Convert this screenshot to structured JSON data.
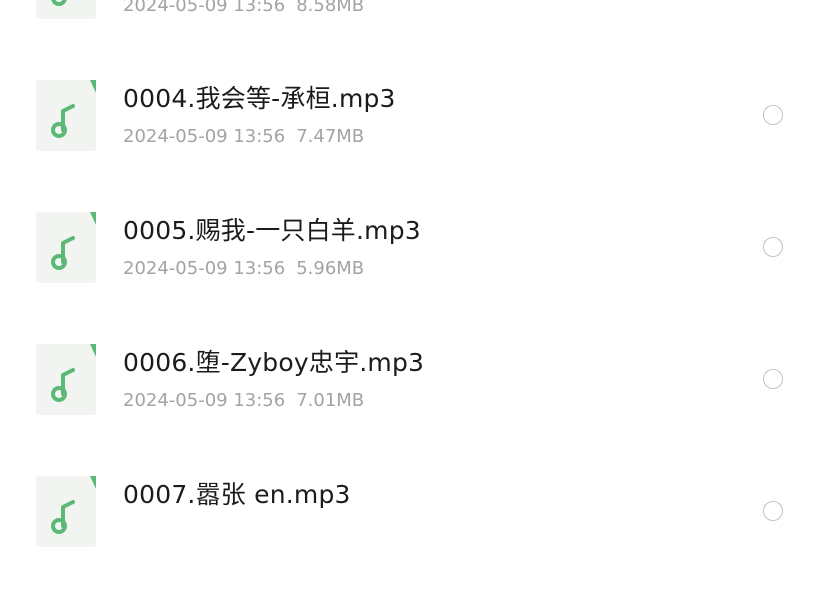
{
  "files": [
    {
      "name": "",
      "date": "2024-05-09 13:56",
      "size": "8.58MB",
      "icon": "music-file-icon"
    },
    {
      "name": "0004.我会等-承桓.mp3",
      "date": "2024-05-09 13:56",
      "size": "7.47MB",
      "icon": "music-file-icon"
    },
    {
      "name": "0005.赐我-一只白羊.mp3",
      "date": "2024-05-09 13:56",
      "size": "5.96MB",
      "icon": "music-file-icon"
    },
    {
      "name": "0006.堕-Zyboy忠宇.mp3",
      "date": "2024-05-09 13:56",
      "size": "7.01MB",
      "icon": "music-file-icon"
    },
    {
      "name": "0007.嚣张 en.mp3",
      "date": "",
      "size": "",
      "icon": "music-file-icon"
    }
  ],
  "colors": {
    "icon_green": "#5cb877",
    "icon_bg": "#f1f4f1",
    "name_text": "#1b1b1b",
    "meta_text": "#a3a3a3",
    "radio_border": "#c4c4c4"
  }
}
